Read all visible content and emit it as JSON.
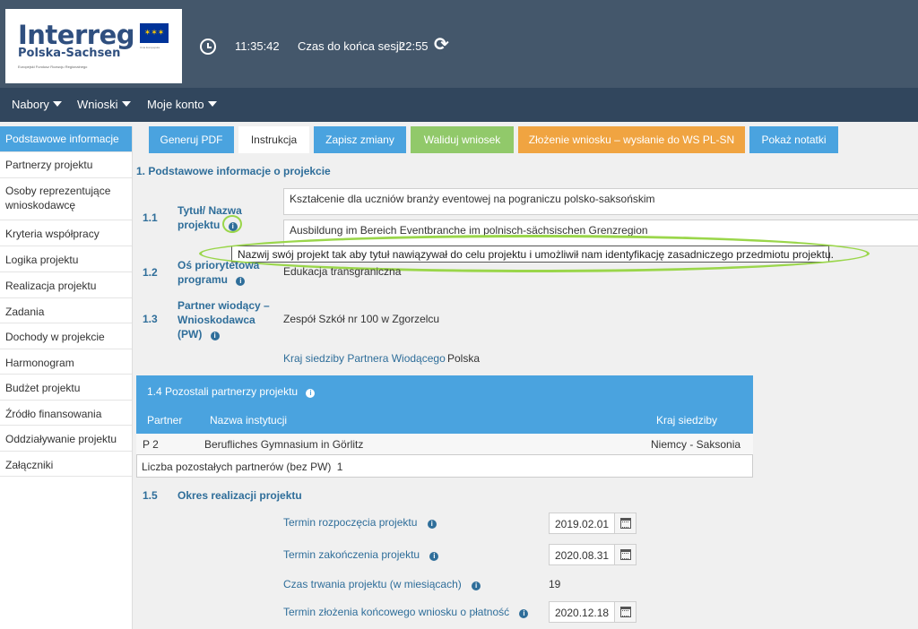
{
  "header": {
    "logo_title": "Interreg",
    "logo_subtitle": "Polska-Sachsen",
    "logo_tiny": "Europejski Fundusz Rozwoju Regionalnego",
    "eu_label": "Unia Europejska",
    "clock_time": "11:35:42",
    "session_label": "Czas do końca sesji:",
    "session_time": "22:55"
  },
  "nav": {
    "items": [
      "Nabory",
      "Wnioski",
      "Moje konto"
    ]
  },
  "sidebar": {
    "items": [
      "Podstawowe informacje",
      "Partnerzy projektu",
      "Osoby reprezentujące wnioskodawcę",
      "Kryteria współpracy",
      "Logika projektu",
      "Realizacja projektu",
      "Zadania",
      "Dochody w projekcie",
      "Harmonogram",
      "Budżet projektu",
      "Źródło finansowania",
      "Oddziaływanie projektu",
      "Załączniki"
    ]
  },
  "toolbar": {
    "pdf": "Generuj PDF",
    "instr": "Instrukcja",
    "save": "Zapisz zmiany",
    "validate": "Waliduj wniosek",
    "submit": "Złożenie wniosku – wysłanie do WS PL-SN",
    "notes": "Pokaż notatki"
  },
  "form": {
    "section_title": "1. Podstawowe informacje o projekcie",
    "s11": {
      "num": "1.1",
      "label_line1": "Tytuł/ Nazwa",
      "label_line2": "projektu",
      "title_pl": "Kształcenie dla uczniów branży eventowej na pograniczu polsko-saksońskim",
      "title_de": "Ausbildung im Bereich Eventbranche im polnisch-sächsischen Grenzregion"
    },
    "tooltip": "Nazwij swój projekt tak aby tytuł nawiązywał do celu projektu i umożliwił nam identyfikację zasadniczego przedmiotu projektu.",
    "s12": {
      "num": "1.2",
      "label_line1": "Oś priorytetowa",
      "label_line2": "programu",
      "value": "Edukacja transgraniczna"
    },
    "s13": {
      "num": "1.3",
      "label_line1": "Partner wiodący –",
      "label_line2": "Wnioskodawca",
      "label_line3": "(PW)",
      "value": "Zespół Szkół nr 100 w Zgorzelcu",
      "country_label": "Kraj siedziby Partnera Wiodącego",
      "country_value": "Polska"
    },
    "s14": {
      "title": "1.4 Pozostali partnerzy projektu",
      "col_partner": "Partner",
      "col_name": "Nazwa instytucji",
      "col_country": "Kraj siedziby",
      "rows": [
        {
          "partner": "P 2",
          "name": "Berufliches Gymnasium in Görlitz",
          "country": "Niemcy - Saksonia"
        }
      ],
      "count_label": "Liczba pozostałych partnerów (bez PW)",
      "count_value": "1"
    },
    "s15": {
      "num": "1.5",
      "title": "Okres realizacji projektu",
      "start_label": "Termin rozpoczęcia projektu",
      "start_value": "2019.02.01",
      "end_label": "Termin zakończenia projektu",
      "end_value": "2020.08.31",
      "duration_label": "Czas trwania projektu (w miesiącach)",
      "duration_value": "19",
      "final_label": "Termin złożenia końcowego wniosku o płatność",
      "final_value": "2020.12.18"
    }
  }
}
